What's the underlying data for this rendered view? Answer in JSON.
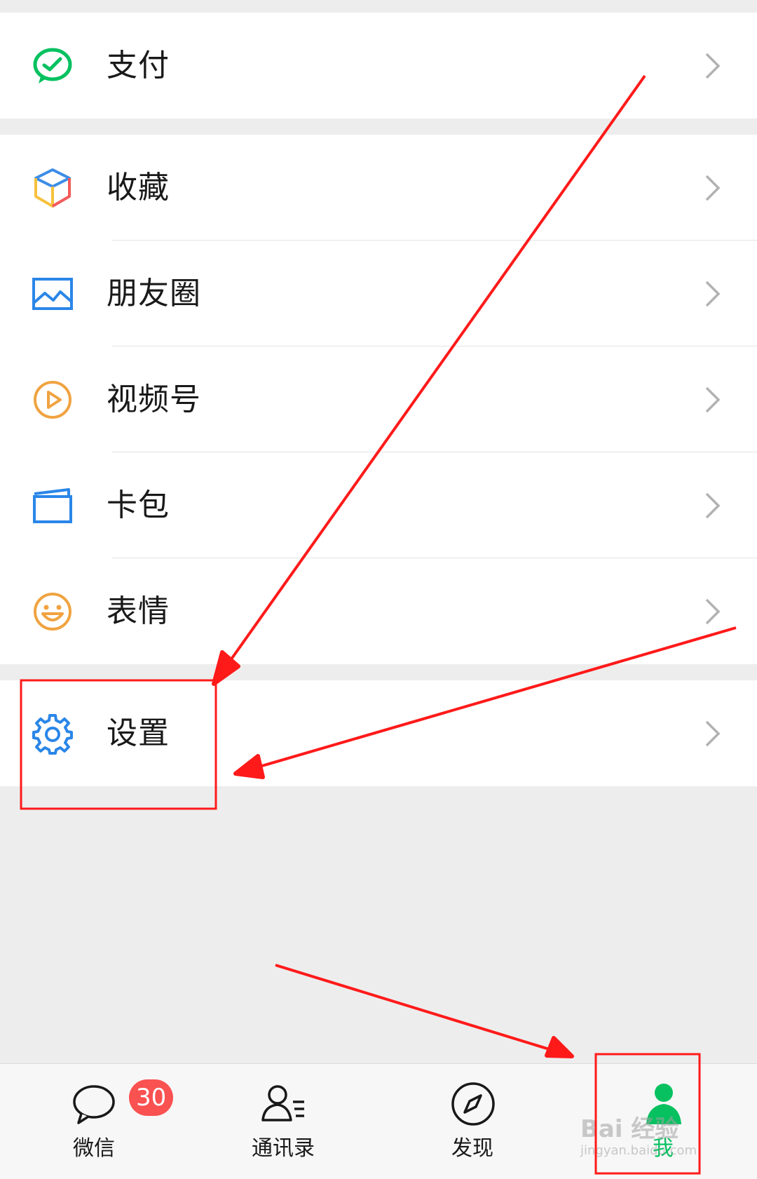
{
  "groups": [
    {
      "items": [
        {
          "key": "pay",
          "label": "支付"
        }
      ]
    },
    {
      "items": [
        {
          "key": "favorites",
          "label": "收藏"
        },
        {
          "key": "moments",
          "label": "朋友圈"
        },
        {
          "key": "channels",
          "label": "视频号"
        },
        {
          "key": "cards",
          "label": "卡包"
        },
        {
          "key": "stickers",
          "label": "表情"
        }
      ]
    },
    {
      "items": [
        {
          "key": "settings",
          "label": "设置"
        }
      ]
    }
  ],
  "tabbar": {
    "tabs": [
      {
        "key": "chats",
        "label": "微信",
        "badge": "30",
        "icon": "chat-bubble-icon"
      },
      {
        "key": "contacts",
        "label": "通讯录",
        "icon": "contacts-icon"
      },
      {
        "key": "discover",
        "label": "发现",
        "icon": "compass-icon"
      },
      {
        "key": "me",
        "label": "我",
        "icon": "person-icon",
        "active": true
      }
    ]
  },
  "watermark": {
    "text": "Bai 经验",
    "sub": "jingyan.baidu.com"
  },
  "colors": {
    "active_green": "#07c160",
    "badge_red": "#fa5151",
    "annotation_red": "#ff1a1a",
    "background": "#ededed"
  }
}
